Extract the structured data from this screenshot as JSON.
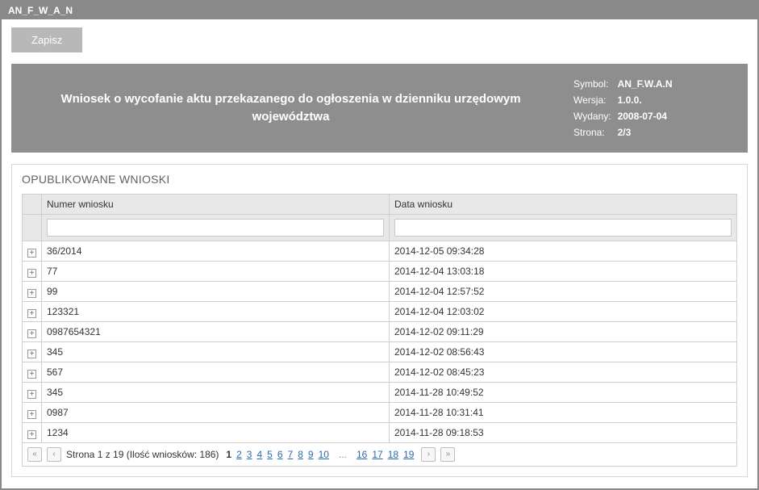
{
  "window": {
    "title": "AN_F_W_A_N"
  },
  "toolbar": {
    "save_label": "Zapisz"
  },
  "header": {
    "title": "Wniosek o wycofanie aktu przekazanego do ogłoszenia w dzienniku urzędowym województwa",
    "meta": {
      "symbol_label": "Symbol:",
      "symbol_value": "AN_F.W.A.N",
      "version_label": "Wersja:",
      "version_value": "1.0.0.",
      "issued_label": "Wydany:",
      "issued_value": "2008-07-04",
      "page_label": "Strona:",
      "page_value": "2/3"
    }
  },
  "section": {
    "title": "OPUBLIKOWANE WNIOSKI"
  },
  "table": {
    "columns": {
      "number": "Numer wniosku",
      "date": "Data wniosku"
    },
    "filters": {
      "number": "",
      "date": ""
    },
    "rows": [
      {
        "number": "36/2014",
        "date": "2014-12-05 09:34:28"
      },
      {
        "number": "77",
        "date": "2014-12-04 13:03:18"
      },
      {
        "number": "99",
        "date": "2014-12-04 12:57:52"
      },
      {
        "number": "123321",
        "date": "2014-12-04 12:03:02"
      },
      {
        "number": "0987654321",
        "date": "2014-12-02 09:11:29"
      },
      {
        "number": "345",
        "date": "2014-12-02 08:56:43"
      },
      {
        "number": "567",
        "date": "2014-12-02 08:45:23"
      },
      {
        "number": "345",
        "date": "2014-11-28 10:49:52"
      },
      {
        "number": "0987",
        "date": "2014-11-28 10:31:41"
      },
      {
        "number": "1234",
        "date": "2014-11-28 09:18:53"
      }
    ]
  },
  "pager": {
    "summary": "Strona 1 z 19 (Ilość wniosków: 186)",
    "first_block": [
      "1",
      "2",
      "3",
      "4",
      "5",
      "6",
      "7",
      "8",
      "9",
      "10"
    ],
    "last_block": [
      "16",
      "17",
      "18",
      "19"
    ],
    "ellipsis": "...",
    "current": "1",
    "first_symbol": "«",
    "prev_symbol": "‹",
    "next_symbol": "›",
    "last_symbol": "»"
  }
}
